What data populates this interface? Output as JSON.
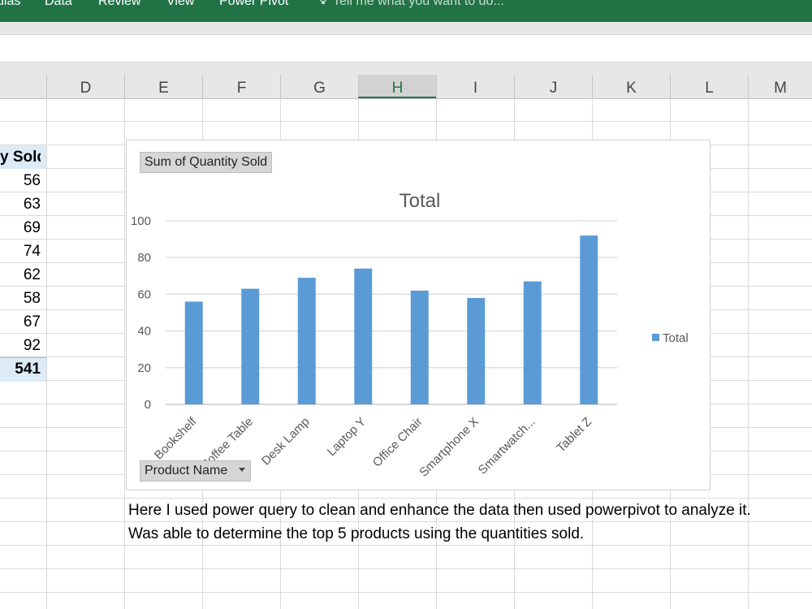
{
  "ribbon": {
    "tabs": [
      "ulas",
      "Data",
      "Review",
      "View",
      "Power Pivot"
    ],
    "tell_me": "Tell me what you want to do...",
    "color": "#217346"
  },
  "columns": {
    "headers": [
      "D",
      "E",
      "F",
      "G",
      "H",
      "I",
      "J",
      "K",
      "L",
      "M"
    ],
    "selected": "H"
  },
  "pivot": {
    "header": "y Sold",
    "values": [
      "56",
      "63",
      "69",
      "74",
      "62",
      "58",
      "67",
      "92"
    ],
    "total": "541"
  },
  "chart": {
    "field_button": "Sum of Quantity Sold",
    "axis_field_button": "Product Name",
    "dropdown_icon": "triangle-down-icon"
  },
  "chart_data": {
    "type": "bar",
    "title": "Total",
    "categories": [
      "Bookshelf",
      "Coffee Table",
      "Desk Lamp",
      "Laptop Y",
      "Office Chair",
      "Smartphone X",
      "Smartwatch...",
      "Tablet Z"
    ],
    "series": [
      {
        "name": "Total",
        "values": [
          56,
          63,
          69,
          74,
          62,
          58,
          67,
          92
        ],
        "color": "#5b9bd5"
      }
    ],
    "ylim": [
      0,
      100
    ],
    "yticks": [
      0,
      20,
      40,
      60,
      80,
      100
    ],
    "grid": true,
    "legend": "right",
    "xlabel": "",
    "ylabel": ""
  },
  "notes": [
    "Here I used power  query to clean and enhance the data then used powerpivot to analyze it.",
    "Was able to determine the top 5 products using the quantities sold."
  ]
}
